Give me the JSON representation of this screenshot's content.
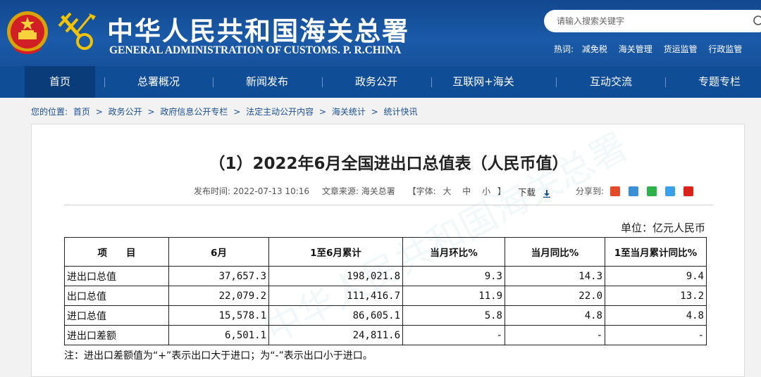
{
  "header": {
    "title_cn": "中华人民共和国海关总署",
    "title_en": "GENERAL ADMINISTRATION OF CUSTOMS. P. R.CHINA",
    "search_placeholder": "请输入搜索关键字",
    "hotwords_label": "热词:",
    "hotwords": [
      "减免税",
      "海关管理",
      "货运监管",
      "行政监管"
    ]
  },
  "nav": {
    "items": [
      "首页",
      "总署概况",
      "新闻发布",
      "政务公开",
      "互联网+海关",
      "互动交流",
      "专题专栏"
    ],
    "active": "首页"
  },
  "breadcrumb": {
    "prefix": "您的位置:",
    "items": [
      "首页",
      "政务公开",
      "政府信息公开专栏",
      "法定主动公开内容",
      "海关统计",
      "统计快讯"
    ],
    "separator": ">"
  },
  "article": {
    "title": "（1）2022年6月全国进出口总值表（人民币值）",
    "publish_label": "发布时间:",
    "publish_time": "2022-07-13 10:16",
    "source_label": "文章来源:",
    "source": "海关总署",
    "font_label": "【字体:",
    "font_sizes": [
      "大",
      "中",
      "小"
    ],
    "font_close": "】",
    "download_label": "下载",
    "share_label": "分享到:",
    "unit": "单位：亿元人民币",
    "note": "注：进出口差额值为“+”表示出口大于进口；为“-”表示出口小于进口。"
  },
  "table": {
    "headers": [
      "项　　目",
      "6月",
      "1至6月累计",
      "当月环比%",
      "当月同比%",
      "1至当月累计同比%"
    ],
    "rows": [
      [
        "进出口总值",
        "37,657.3",
        "198,021.8",
        "9.3",
        "14.3",
        "9.4"
      ],
      [
        "出口总值",
        "22,079.2",
        "111,416.7",
        "11.9",
        "22.0",
        "13.2"
      ],
      [
        "进口总值",
        "15,578.1",
        "86,605.1",
        "5.8",
        "4.8",
        "4.8"
      ],
      [
        "进出口差额",
        "6,501.1",
        "24,811.6",
        "-",
        "-",
        "-"
      ]
    ]
  },
  "colors": {
    "header_bg": "#1a5aa8",
    "nav_bg": "#0f4d96",
    "nav_active": "#0a3c7a",
    "link": "#1b4f93"
  }
}
